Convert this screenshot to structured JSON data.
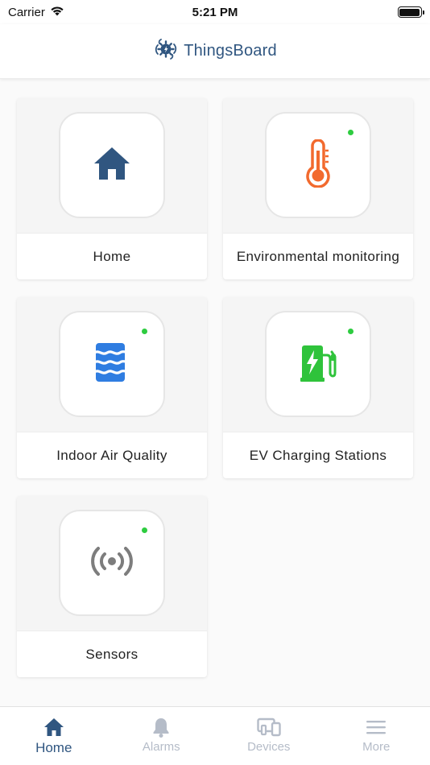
{
  "status_bar": {
    "carrier": "Carrier",
    "time": "5:21 PM"
  },
  "header": {
    "brand": "ThingsBoard",
    "logo_icon": "thingsboard-logo-icon",
    "brand_color": "#305680"
  },
  "tiles": [
    {
      "label": "Home",
      "icon": "house-icon",
      "icon_color": "#305680",
      "online": false
    },
    {
      "label": "Environmental monitoring",
      "icon": "thermometer-icon",
      "icon_color": "#f26a2e",
      "online": true
    },
    {
      "label": "Indoor Air Quality",
      "icon": "air-quality-icon",
      "icon_color": "#2f7de1",
      "online": true
    },
    {
      "label": "EV Charging Stations",
      "icon": "ev-charger-icon",
      "icon_color": "#2fc33b",
      "online": true
    },
    {
      "label": "Sensors",
      "icon": "sensor-signal-icon",
      "icon_color": "#7d7d7d",
      "online": true
    }
  ],
  "online_dot_color": "#2ecc40",
  "bottom_nav": {
    "items": [
      {
        "label": "Home",
        "icon": "home-icon",
        "active": true
      },
      {
        "label": "Alarms",
        "icon": "bell-icon",
        "active": false
      },
      {
        "label": "Devices",
        "icon": "devices-icon",
        "active": false
      },
      {
        "label": "More",
        "icon": "menu-icon",
        "active": false
      }
    ],
    "active_color": "#305680",
    "inactive_color": "#b5bcc8"
  }
}
